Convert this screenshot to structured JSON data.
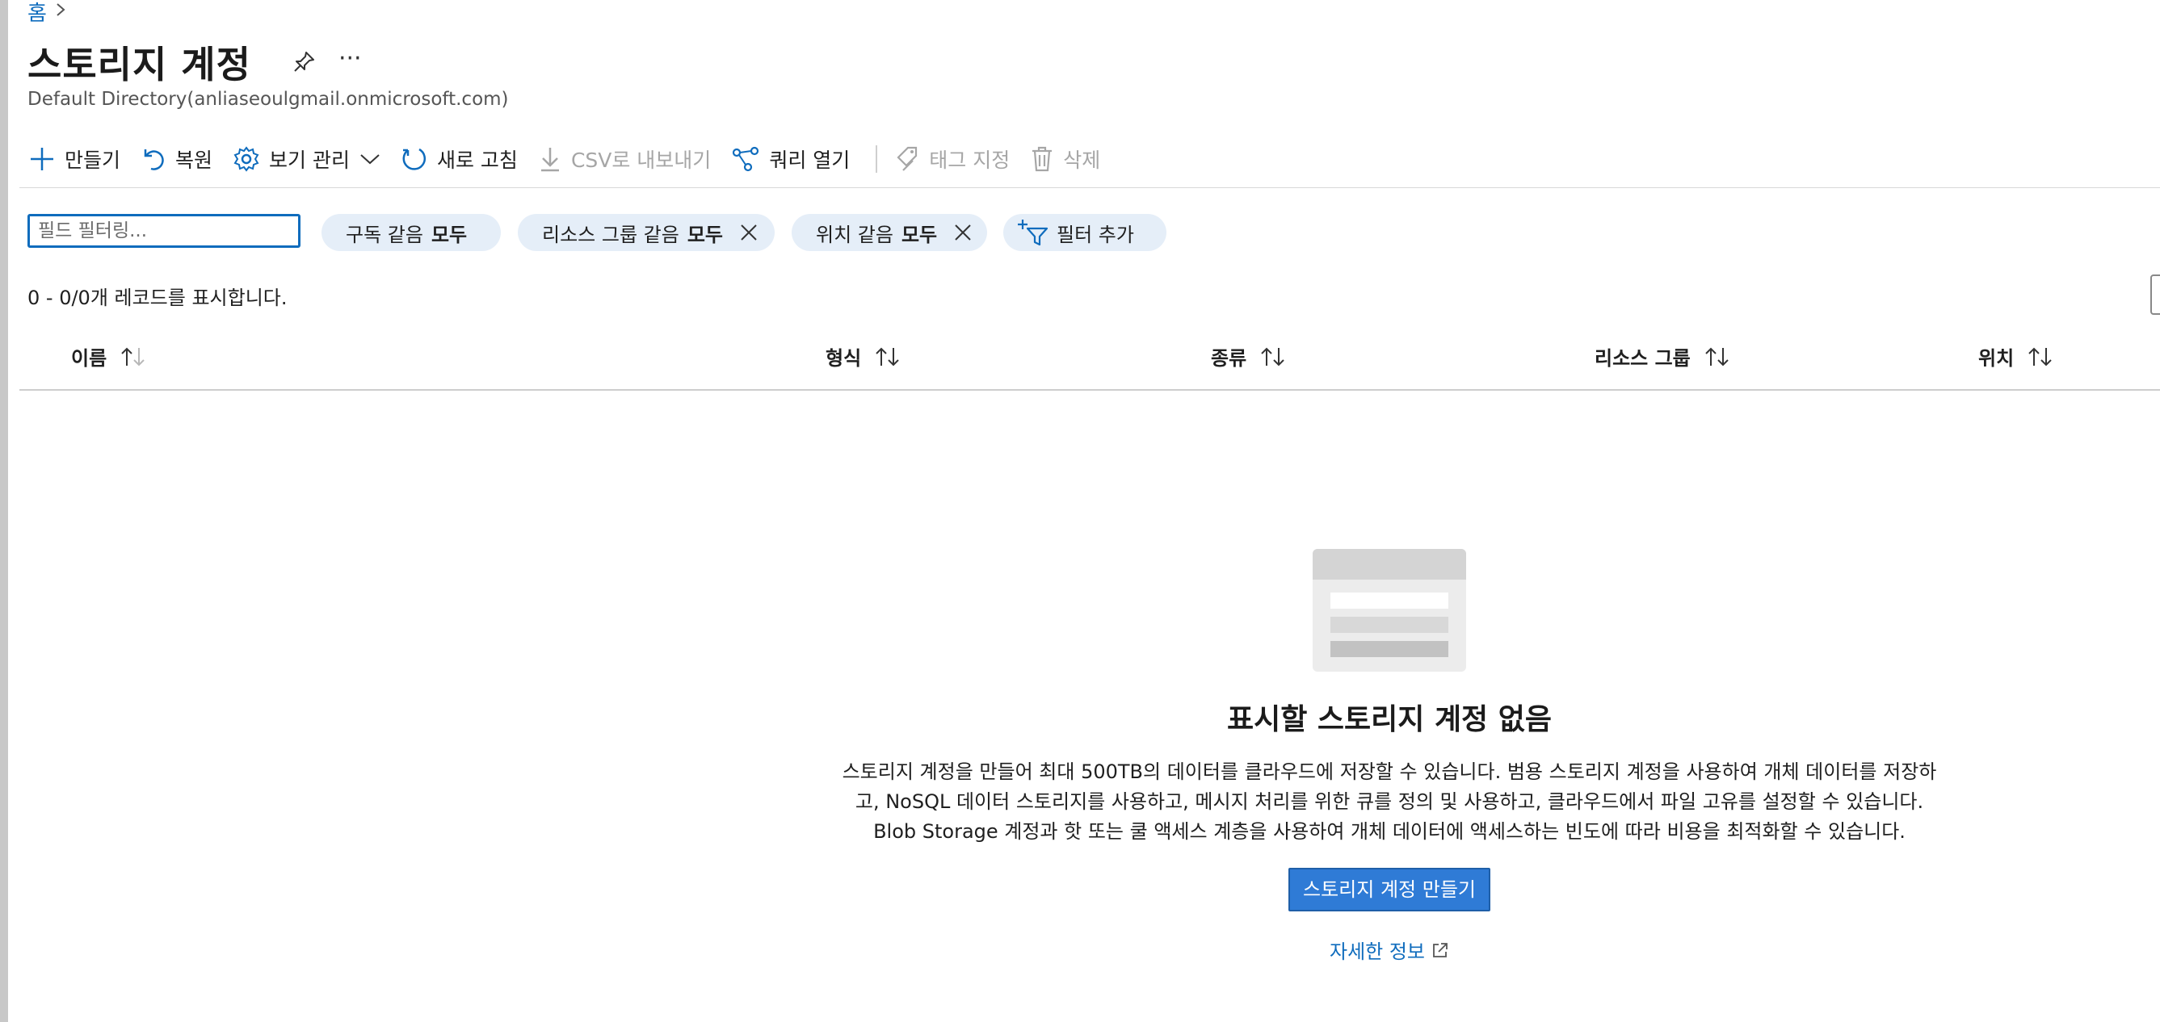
{
  "breadcrumb": {
    "home": "홈",
    "separator": ">"
  },
  "header": {
    "title": "스토리지 계정",
    "subtitle": "Default Directory(anliaseoulgmail.onmicrosoft.com)",
    "more": "···"
  },
  "toolbar": {
    "create": "만들기",
    "restore": "복원",
    "manage_view": "보기 관리",
    "refresh": "새로 고침",
    "export_csv": "CSV로 내보내기",
    "open_query": "쿼리 열기",
    "assign_tags": "태그 지정",
    "delete": "삭제"
  },
  "filters": {
    "search_placeholder": "필드 필터링...",
    "pills": [
      {
        "label": "구독 같음",
        "value": "모두"
      },
      {
        "label": "리소스 그룹 같음",
        "value": "모두"
      },
      {
        "label": "위치 같음",
        "value": "모두"
      }
    ],
    "add_filter": "필터 추가"
  },
  "records": {
    "summary": "0 - 0/0개 레코드를 표시합니다."
  },
  "table": {
    "columns": [
      "이름",
      "형식",
      "종류",
      "리소스 그룹",
      "위치"
    ]
  },
  "empty_state": {
    "title": "표시할 스토리지 계정 없음",
    "description": "스토리지 계정을 만들어 최대 500TB의 데이터를 클라우드에 저장할 수 있습니다. 범용 스토리지 계정을 사용하여 개체 데이터를 저장하고, NoSQL 데이터 스토리지를 사용하고, 메시지 처리를 위한 큐를 정의 및 사용하고, 클라우드에서 파일 고유를 설정할 수 있습니다. Blob Storage 계정과 핫 또는 쿨 액세스 계층을 사용하여 개체 데이터에 액세스하는 빈도에 따라 비용을 최적화할 수 있습니다.",
    "create_button": "스토리지 계정 만들기",
    "learn_more": "자세한 정보"
  },
  "colors": {
    "accent": "#0f6cbd",
    "button": "#2f7bd6",
    "pill": "#e5eef8",
    "disabled": "#a6a6a6"
  },
  "icons": [
    "chevron-right-icon",
    "pin-icon",
    "more-icon",
    "plus-icon",
    "undo-icon",
    "gear-icon",
    "chevron-down-icon",
    "refresh-icon",
    "download-icon",
    "query-icon",
    "tag-icon",
    "trash-icon",
    "close-icon",
    "add-filter-icon",
    "sort-icon",
    "external-link-icon"
  ]
}
